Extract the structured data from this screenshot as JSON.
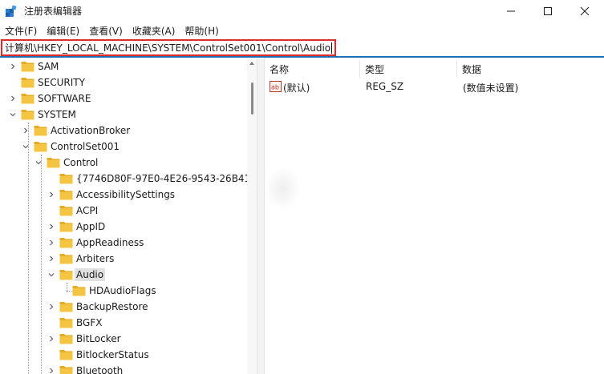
{
  "window": {
    "title": "注册表编辑器",
    "icon": "regedit-icon"
  },
  "menu": {
    "items": [
      {
        "label": "文件(F)"
      },
      {
        "label": "编辑(E)"
      },
      {
        "label": "查看(V)"
      },
      {
        "label": "收藏夹(A)"
      },
      {
        "label": "帮助(H)"
      }
    ]
  },
  "address": {
    "path": "计算机\\HKEY_LOCAL_MACHINE\\SYSTEM\\ControlSet001\\Control\\Audio"
  },
  "tree": {
    "items": [
      {
        "label": "SAM",
        "depth": 1,
        "expander": "collapsed"
      },
      {
        "label": "SECURITY",
        "depth": 1,
        "expander": "none"
      },
      {
        "label": "SOFTWARE",
        "depth": 1,
        "expander": "collapsed"
      },
      {
        "label": "SYSTEM",
        "depth": 1,
        "expander": "expanded"
      },
      {
        "label": "ActivationBroker",
        "depth": 2,
        "expander": "collapsed"
      },
      {
        "label": "ControlSet001",
        "depth": 2,
        "expander": "expanded"
      },
      {
        "label": "Control",
        "depth": 3,
        "expander": "expanded"
      },
      {
        "label": "{7746D80F-97E0-4E26-9543-26B41",
        "depth": 4,
        "expander": "none"
      },
      {
        "label": "AccessibilitySettings",
        "depth": 4,
        "expander": "collapsed"
      },
      {
        "label": "ACPI",
        "depth": 4,
        "expander": "none"
      },
      {
        "label": "AppID",
        "depth": 4,
        "expander": "collapsed"
      },
      {
        "label": "AppReadiness",
        "depth": 4,
        "expander": "collapsed"
      },
      {
        "label": "Arbiters",
        "depth": 4,
        "expander": "collapsed"
      },
      {
        "label": "Audio",
        "depth": 4,
        "expander": "expanded",
        "selected": true
      },
      {
        "label": "HDAudioFlags",
        "depth": 5,
        "expander": "none"
      },
      {
        "label": "BackupRestore",
        "depth": 4,
        "expander": "collapsed"
      },
      {
        "label": "BGFX",
        "depth": 4,
        "expander": "none"
      },
      {
        "label": "BitLocker",
        "depth": 4,
        "expander": "collapsed"
      },
      {
        "label": "BitlockerStatus",
        "depth": 4,
        "expander": "none"
      },
      {
        "label": "Bluetooth",
        "depth": 4,
        "expander": "collapsed"
      }
    ]
  },
  "list": {
    "columns": [
      {
        "label": "名称"
      },
      {
        "label": "类型"
      },
      {
        "label": "数据"
      }
    ],
    "rows": [
      {
        "name": "(默认)",
        "type": "REG_SZ",
        "data": "(数值未设置)",
        "icon": "string-value-icon"
      }
    ]
  },
  "colors": {
    "folder": "#f4c542",
    "address_highlight": "#e02b2b",
    "accent": "#1f6fb2",
    "selection": "#e1e1e1"
  }
}
